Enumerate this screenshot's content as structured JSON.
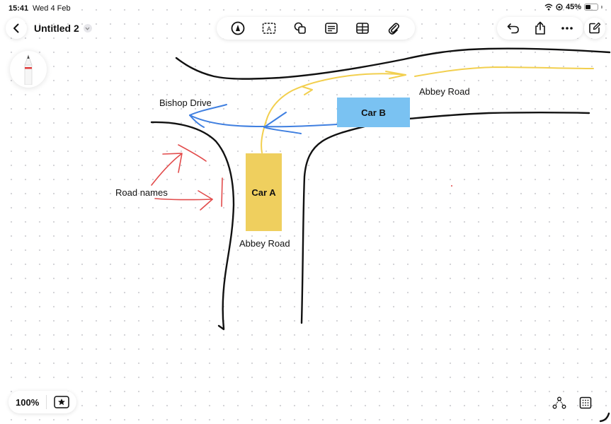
{
  "status_bar": {
    "time": "15:41",
    "date": "Wed 4 Feb",
    "battery": "45%",
    "battery_level": 0.45
  },
  "toolbar": {
    "title": "Untitled 2",
    "tools": [
      "pen-tool",
      "text-box",
      "shapes",
      "notes",
      "table",
      "attachment"
    ],
    "right_actions": [
      "undo",
      "share",
      "more",
      "new-board"
    ]
  },
  "canvas": {
    "labels": {
      "bishop_drive": "Bishop Drive",
      "abbey_road_top": "Abbey Road",
      "abbey_road_bottom": "Abbey Road",
      "road_names": "Road names"
    },
    "cars": {
      "car_a": {
        "label": "Car A",
        "color": "#efcf5e"
      },
      "car_b": {
        "label": "Car B",
        "color": "#7ac2f2"
      }
    },
    "stroke_colors": {
      "road": "#111111",
      "yellow_path": "#f2cf4e",
      "blue_path": "#3f7fe0",
      "red_arrows": "#e24b4b"
    }
  },
  "bottom_bar": {
    "zoom": "100%"
  }
}
